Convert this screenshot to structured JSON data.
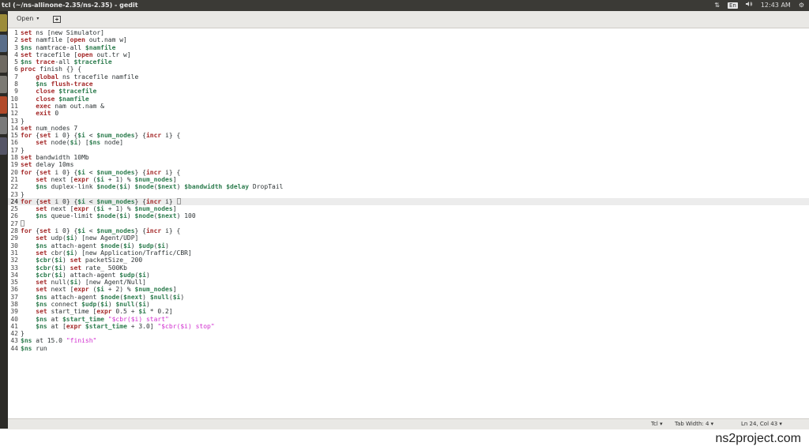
{
  "window": {
    "title": "tcl (~/ns-allinone-2.35/ns-2.35) - gedit"
  },
  "tray": {
    "lang": "En",
    "volume_icon": "speaker-icon",
    "time": "12:43 AM"
  },
  "toolbar": {
    "open_label": "Open"
  },
  "status": {
    "language": "Tcl",
    "tab_width": "Tab Width: 4",
    "position": "Ln 24, Col 43"
  },
  "watermark": "ns2project.com",
  "editor": {
    "current_line": 24,
    "lines": [
      [
        [
          "kw",
          "set"
        ],
        [
          "t",
          " ns [new Simulator]"
        ]
      ],
      [
        [
          "kw",
          "set"
        ],
        [
          "t",
          " namfile ["
        ],
        [
          "kw",
          "open"
        ],
        [
          "t",
          " out.nam w]"
        ]
      ],
      [
        [
          "var",
          "$ns"
        ],
        [
          "t",
          " namtrace-all "
        ],
        [
          "var",
          "$namfile"
        ]
      ],
      [
        [
          "kw",
          "set"
        ],
        [
          "t",
          " tracefile ["
        ],
        [
          "kw",
          "open"
        ],
        [
          "t",
          " out.tr w]"
        ]
      ],
      [
        [
          "var",
          "$ns"
        ],
        [
          "t",
          " "
        ],
        [
          "kw",
          "trace"
        ],
        [
          "t",
          "-all "
        ],
        [
          "var",
          "$tracefile"
        ]
      ],
      [
        [
          "kw",
          "proc"
        ],
        [
          "t",
          " finish {} {"
        ]
      ],
      [
        [
          "t",
          "    "
        ],
        [
          "kw",
          "global"
        ],
        [
          "t",
          " ns tracefile namfile"
        ]
      ],
      [
        [
          "t",
          "    "
        ],
        [
          "var",
          "$ns"
        ],
        [
          "t",
          " "
        ],
        [
          "kw",
          "flush-trace"
        ]
      ],
      [
        [
          "t",
          "    "
        ],
        [
          "kw",
          "close"
        ],
        [
          "t",
          " "
        ],
        [
          "var",
          "$tracefile"
        ]
      ],
      [
        [
          "t",
          "    "
        ],
        [
          "kw",
          "close"
        ],
        [
          "t",
          " "
        ],
        [
          "var",
          "$namfile"
        ]
      ],
      [
        [
          "t",
          "    "
        ],
        [
          "kw",
          "exec"
        ],
        [
          "t",
          " nam out.nam &"
        ]
      ],
      [
        [
          "t",
          "    "
        ],
        [
          "kw",
          "exit"
        ],
        [
          "t",
          " 0"
        ]
      ],
      [
        [
          "t",
          "}"
        ]
      ],
      [
        [
          "kw",
          "set"
        ],
        [
          "t",
          " num_nodes 7"
        ]
      ],
      [
        [
          "kw",
          "for"
        ],
        [
          "t",
          " {"
        ],
        [
          "kw",
          "set"
        ],
        [
          "t",
          " i 0} {"
        ],
        [
          "var",
          "$i"
        ],
        [
          "t",
          " < "
        ],
        [
          "var",
          "$num_nodes"
        ],
        [
          "t",
          "} {"
        ],
        [
          "kw",
          "incr"
        ],
        [
          "t",
          " i} {"
        ]
      ],
      [
        [
          "t",
          "    "
        ],
        [
          "kw",
          "set"
        ],
        [
          "t",
          " node("
        ],
        [
          "var",
          "$i"
        ],
        [
          "t",
          ") ["
        ],
        [
          "var",
          "$ns"
        ],
        [
          "t",
          " node]"
        ]
      ],
      [
        [
          "t",
          "}"
        ]
      ],
      [
        [
          "kw",
          "set"
        ],
        [
          "t",
          " bandwidth 10Mb"
        ]
      ],
      [
        [
          "kw",
          "set"
        ],
        [
          "t",
          " delay 10ms"
        ]
      ],
      [
        [
          "kw",
          "for"
        ],
        [
          "t",
          " {"
        ],
        [
          "kw",
          "set"
        ],
        [
          "t",
          " i 0} {"
        ],
        [
          "var",
          "$i"
        ],
        [
          "t",
          " < "
        ],
        [
          "var",
          "$num_nodes"
        ],
        [
          "t",
          "} {"
        ],
        [
          "kw",
          "incr"
        ],
        [
          "t",
          " i} {"
        ]
      ],
      [
        [
          "t",
          "    "
        ],
        [
          "kw",
          "set"
        ],
        [
          "t",
          " next ["
        ],
        [
          "kw",
          "expr"
        ],
        [
          "t",
          " ("
        ],
        [
          "var",
          "$i"
        ],
        [
          "t",
          " + 1) % "
        ],
        [
          "var",
          "$num_nodes"
        ],
        [
          "t",
          "]"
        ]
      ],
      [
        [
          "t",
          "    "
        ],
        [
          "var",
          "$ns"
        ],
        [
          "t",
          " duplex-link "
        ],
        [
          "var",
          "$node"
        ],
        [
          "t",
          "("
        ],
        [
          "var",
          "$i"
        ],
        [
          "t",
          ") "
        ],
        [
          "var",
          "$node"
        ],
        [
          "t",
          "("
        ],
        [
          "var",
          "$next"
        ],
        [
          "t",
          ") "
        ],
        [
          "var",
          "$bandwidth"
        ],
        [
          "t",
          " "
        ],
        [
          "var",
          "$delay"
        ],
        [
          "t",
          " DropTail"
        ]
      ],
      [
        [
          "t",
          "}"
        ]
      ],
      [
        [
          "kw",
          "for"
        ],
        [
          "t",
          " {"
        ],
        [
          "kw",
          "set"
        ],
        [
          "t",
          " i 0} {"
        ],
        [
          "var",
          "$i"
        ],
        [
          "t",
          " < "
        ],
        [
          "var",
          "$num_nodes"
        ],
        [
          "t",
          "} {"
        ],
        [
          "kw",
          "incr"
        ],
        [
          "t",
          " i} "
        ],
        [
          "caret",
          ""
        ]
      ],
      [
        [
          "t",
          "    "
        ],
        [
          "kw",
          "set"
        ],
        [
          "t",
          " next ["
        ],
        [
          "kw",
          "expr"
        ],
        [
          "t",
          " ("
        ],
        [
          "var",
          "$i"
        ],
        [
          "t",
          " + 1) % "
        ],
        [
          "var",
          "$num_nodes"
        ],
        [
          "t",
          "]"
        ]
      ],
      [
        [
          "t",
          "    "
        ],
        [
          "var",
          "$ns"
        ],
        [
          "t",
          " queue-limit "
        ],
        [
          "var",
          "$node"
        ],
        [
          "t",
          "("
        ],
        [
          "var",
          "$i"
        ],
        [
          "t",
          ") "
        ],
        [
          "var",
          "$node"
        ],
        [
          "t",
          "("
        ],
        [
          "var",
          "$next"
        ],
        [
          "t",
          ") 100"
        ]
      ],
      [
        [
          "caret",
          ""
        ]
      ],
      [
        [
          "kw",
          "for"
        ],
        [
          "t",
          " {"
        ],
        [
          "kw",
          "set"
        ],
        [
          "t",
          " i 0} {"
        ],
        [
          "var",
          "$i"
        ],
        [
          "t",
          " < "
        ],
        [
          "var",
          "$num_nodes"
        ],
        [
          "t",
          "} {"
        ],
        [
          "kw",
          "incr"
        ],
        [
          "t",
          " i} {"
        ]
      ],
      [
        [
          "t",
          "    "
        ],
        [
          "kw",
          "set"
        ],
        [
          "t",
          " udp("
        ],
        [
          "var",
          "$i"
        ],
        [
          "t",
          ") [new Agent/UDP]"
        ]
      ],
      [
        [
          "t",
          "    "
        ],
        [
          "var",
          "$ns"
        ],
        [
          "t",
          " attach-agent "
        ],
        [
          "var",
          "$node"
        ],
        [
          "t",
          "("
        ],
        [
          "var",
          "$i"
        ],
        [
          "t",
          ") "
        ],
        [
          "var",
          "$udp"
        ],
        [
          "t",
          "("
        ],
        [
          "var",
          "$i"
        ],
        [
          "t",
          ")"
        ]
      ],
      [
        [
          "t",
          "    "
        ],
        [
          "kw",
          "set"
        ],
        [
          "t",
          " cbr("
        ],
        [
          "var",
          "$i"
        ],
        [
          "t",
          ") [new Application/Traffic/CBR]"
        ]
      ],
      [
        [
          "t",
          "    "
        ],
        [
          "var",
          "$cbr"
        ],
        [
          "t",
          "("
        ],
        [
          "var",
          "$i"
        ],
        [
          "t",
          ") "
        ],
        [
          "kw",
          "set"
        ],
        [
          "t",
          " packetSize_ 200"
        ]
      ],
      [
        [
          "t",
          "    "
        ],
        [
          "var",
          "$cbr"
        ],
        [
          "t",
          "("
        ],
        [
          "var",
          "$i"
        ],
        [
          "t",
          ") "
        ],
        [
          "kw",
          "set"
        ],
        [
          "t",
          " rate_ 500Kb"
        ]
      ],
      [
        [
          "t",
          "    "
        ],
        [
          "var",
          "$cbr"
        ],
        [
          "t",
          "("
        ],
        [
          "var",
          "$i"
        ],
        [
          "t",
          ") attach-agent "
        ],
        [
          "var",
          "$udp"
        ],
        [
          "t",
          "("
        ],
        [
          "var",
          "$i"
        ],
        [
          "t",
          ")"
        ]
      ],
      [
        [
          "t",
          "    "
        ],
        [
          "kw",
          "set"
        ],
        [
          "t",
          " null("
        ],
        [
          "var",
          "$i"
        ],
        [
          "t",
          ") [new Agent/Null]"
        ]
      ],
      [
        [
          "t",
          "    "
        ],
        [
          "kw",
          "set"
        ],
        [
          "t",
          " next ["
        ],
        [
          "kw",
          "expr"
        ],
        [
          "t",
          " ("
        ],
        [
          "var",
          "$i"
        ],
        [
          "t",
          " + 2) % "
        ],
        [
          "var",
          "$num_nodes"
        ],
        [
          "t",
          "]"
        ]
      ],
      [
        [
          "t",
          "    "
        ],
        [
          "var",
          "$ns"
        ],
        [
          "t",
          " attach-agent "
        ],
        [
          "var",
          "$node"
        ],
        [
          "t",
          "("
        ],
        [
          "var",
          "$next"
        ],
        [
          "t",
          ") "
        ],
        [
          "var",
          "$null"
        ],
        [
          "t",
          "("
        ],
        [
          "var",
          "$i"
        ],
        [
          "t",
          ")"
        ]
      ],
      [
        [
          "t",
          "    "
        ],
        [
          "var",
          "$ns"
        ],
        [
          "t",
          " connect "
        ],
        [
          "var",
          "$udp"
        ],
        [
          "t",
          "("
        ],
        [
          "var",
          "$i"
        ],
        [
          "t",
          ") "
        ],
        [
          "var",
          "$null"
        ],
        [
          "t",
          "("
        ],
        [
          "var",
          "$i"
        ],
        [
          "t",
          ")"
        ]
      ],
      [
        [
          "t",
          "    "
        ],
        [
          "kw",
          "set"
        ],
        [
          "t",
          " start_time ["
        ],
        [
          "kw",
          "expr"
        ],
        [
          "t",
          " 0.5 + "
        ],
        [
          "var",
          "$i"
        ],
        [
          "t",
          " * 0.2]"
        ]
      ],
      [
        [
          "t",
          "    "
        ],
        [
          "var",
          "$ns"
        ],
        [
          "t",
          " at "
        ],
        [
          "var",
          "$start_time"
        ],
        [
          "t",
          " "
        ],
        [
          "str",
          "\"$cbr($i) start\""
        ]
      ],
      [
        [
          "t",
          "    "
        ],
        [
          "var",
          "$ns"
        ],
        [
          "t",
          " at ["
        ],
        [
          "kw",
          "expr"
        ],
        [
          "t",
          " "
        ],
        [
          "var",
          "$start_time"
        ],
        [
          "t",
          " + 3.0] "
        ],
        [
          "str",
          "\"$cbr($i) stop\""
        ]
      ],
      [
        [
          "t",
          "}"
        ]
      ],
      [
        [
          "var",
          "$ns"
        ],
        [
          "t",
          " at 15.0 "
        ],
        [
          "str",
          "\"finish\""
        ]
      ],
      [
        [
          "var",
          "$ns"
        ],
        [
          "t",
          " run"
        ]
      ]
    ]
  }
}
